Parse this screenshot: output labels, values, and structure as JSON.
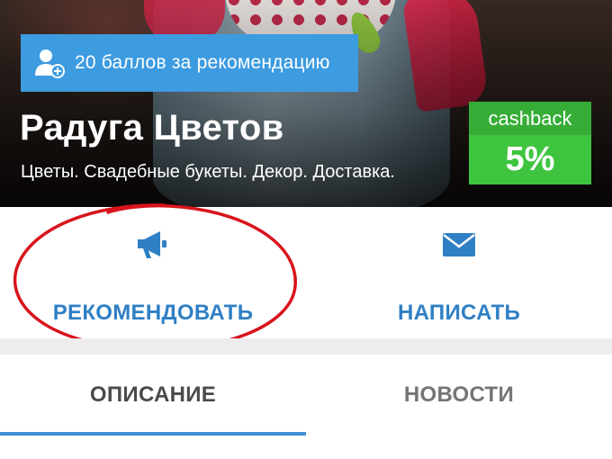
{
  "hero": {
    "referral_label": "20 баллов за рекомендацию",
    "referral_icon": "add-user-icon",
    "title": "Радуга Цветов",
    "subtitle": "Цветы. Свадебные букеты. Декор. Доставка.",
    "cashback": {
      "label": "cashback",
      "value": "5%"
    }
  },
  "actions": {
    "recommend": {
      "label": "РЕКОМЕНДОВАТЬ",
      "icon": "megaphone-icon"
    },
    "write": {
      "label": "НАПИСАТЬ",
      "icon": "envelope-icon"
    }
  },
  "tabs": [
    {
      "label": "ОПИСАНИЕ",
      "active": true
    },
    {
      "label": "НОВОСТИ",
      "active": false
    }
  ],
  "colors": {
    "accent_blue": "#2f7fc4",
    "banner_blue": "#3d9be0",
    "cashback_green": "#3fc43f",
    "annotation_red": "#d8141c"
  }
}
